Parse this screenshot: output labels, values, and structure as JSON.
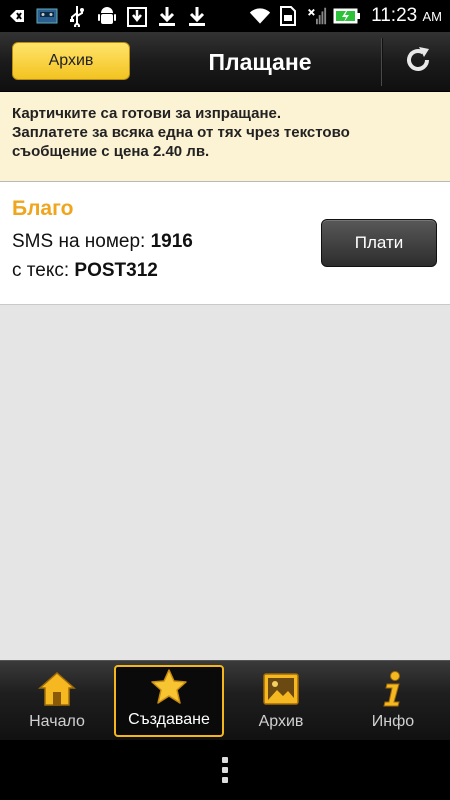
{
  "status_bar": {
    "time": "11:23",
    "ampm": "AM",
    "icons": [
      "back-icon",
      "cassette-icon",
      "usb-icon",
      "android-debug-icon",
      "download-box-icon",
      "download-icon",
      "download-icon",
      "wifi-icon",
      "sim-icon",
      "signal-icon",
      "battery-charging-icon"
    ]
  },
  "action_bar": {
    "archive_button": "Архив",
    "title": "Плащане",
    "refresh_icon": "refresh-icon"
  },
  "banner": {
    "line1": "Картичките са готови за изпращане.",
    "line2": "Заплатете за всяка една от тях чрез текстово",
    "line3": "съобщение с цена 2.40 лв."
  },
  "card": {
    "name": "Благо",
    "sms_label": "SMS на номер: ",
    "sms_number": "1916",
    "text_label": "с текс: ",
    "text_value": "POST312",
    "pay_button": "Плати"
  },
  "tabs": [
    {
      "label": "Начало",
      "icon": "home-icon",
      "active": false
    },
    {
      "label": "Създаване",
      "icon": "star-icon",
      "active": true
    },
    {
      "label": "Архив",
      "icon": "picture-icon",
      "active": false
    },
    {
      "label": "Инфо",
      "icon": "info-icon",
      "active": false
    }
  ],
  "colors": {
    "accent": "#f3b71d",
    "banner_bg": "#fcf2d4",
    "name_color": "#f0a51e"
  }
}
